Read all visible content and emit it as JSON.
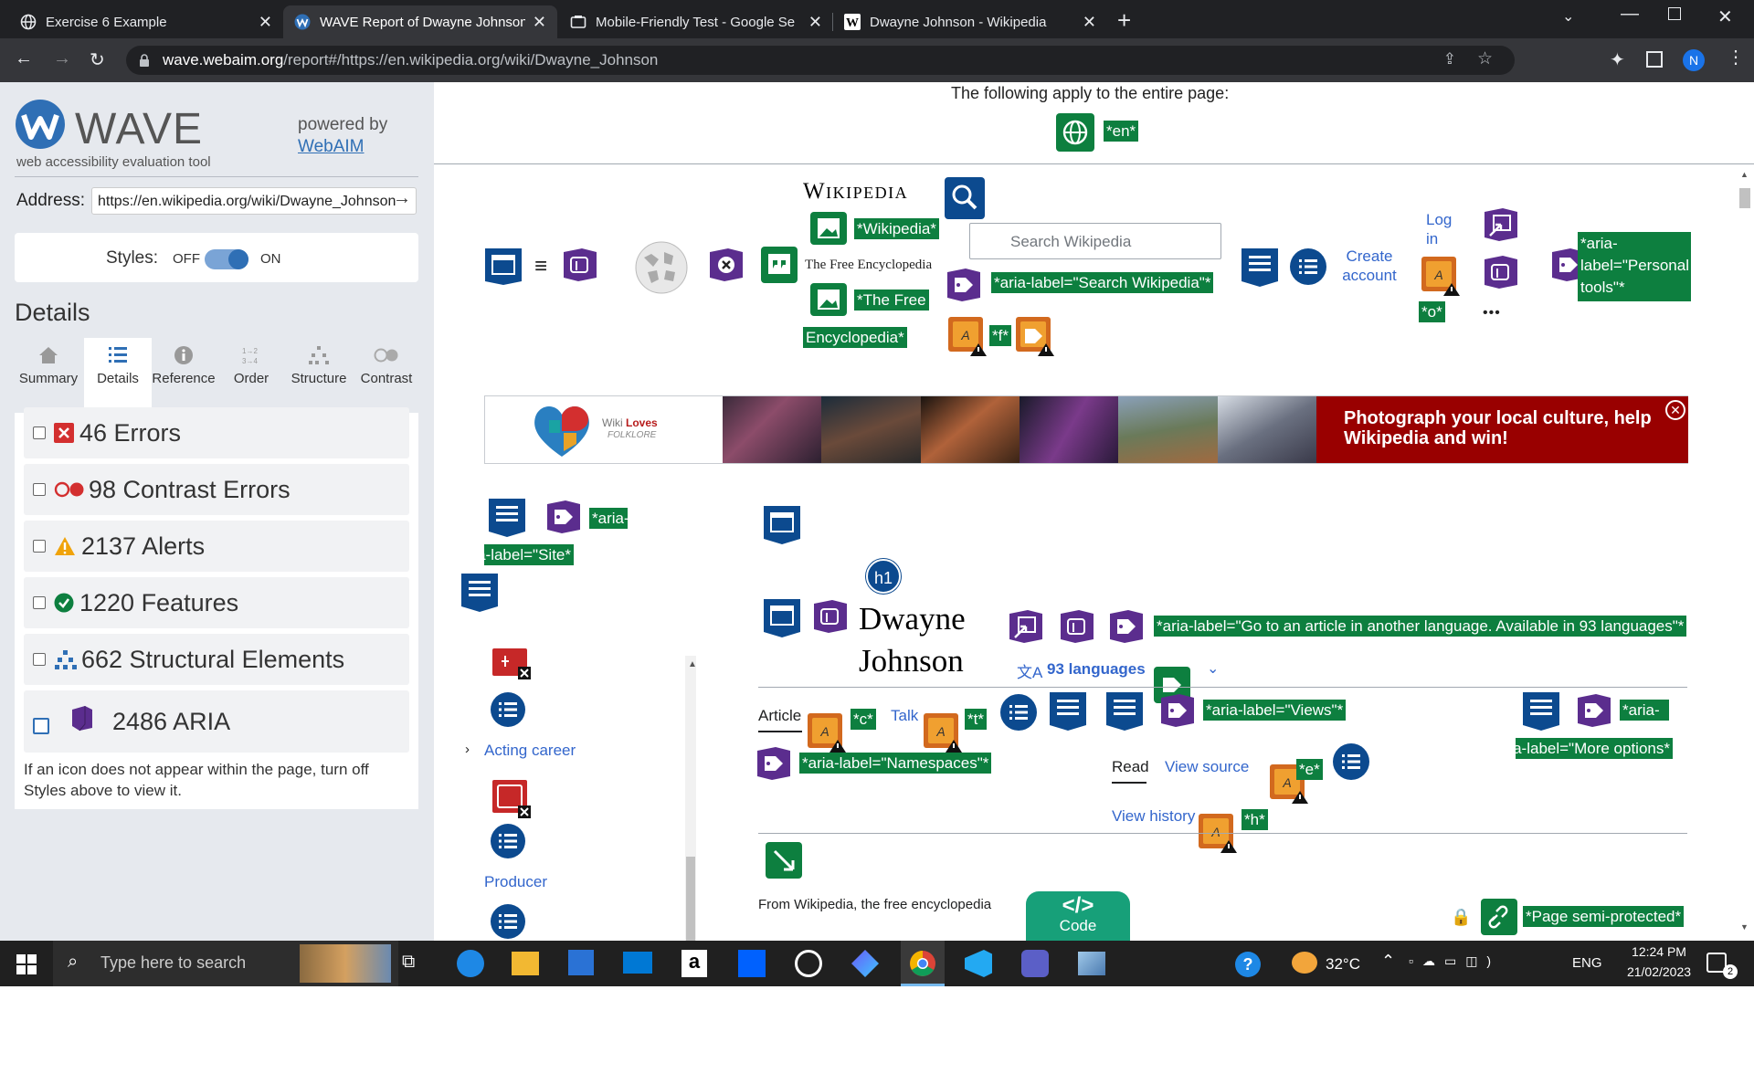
{
  "browser": {
    "tabs": [
      {
        "title": "Exercise 6 Example"
      },
      {
        "title": "WAVE Report of Dwayne Johnson"
      },
      {
        "title": "Mobile-Friendly Test - Google Se"
      },
      {
        "title": "Dwayne Johnson - Wikipedia"
      }
    ],
    "url_host": "wave.webaim.org",
    "url_path": "/report#/https://en.wikipedia.org/wiki/Dwayne_Johnson",
    "profile_initial": "N"
  },
  "sidebar": {
    "logo_text": "WAVE",
    "tagline": "web accessibility evaluation tool",
    "powered_by": "powered by",
    "webaim_link": "WebAIM",
    "address_label": "Address:",
    "address_value": "https://en.wikipedia.org/wiki/Dwayne_Johnson",
    "styles_label": "Styles:",
    "styles_off": "OFF",
    "styles_on": "ON",
    "details_heading": "Details",
    "tabs": [
      "Summary",
      "Details",
      "Reference",
      "Order",
      "Structure",
      "Contrast"
    ],
    "active_tab": "Details",
    "rows": [
      {
        "label": "46 Errors",
        "icon": "error-icon",
        "color": "#d32f2f"
      },
      {
        "label": "98 Contrast Errors",
        "icon": "contrast-icon",
        "color": "#d32f2f"
      },
      {
        "label": "2137 Alerts",
        "icon": "alert-icon",
        "color": "#f0a30a"
      },
      {
        "label": "1220 Features",
        "icon": "feature-icon",
        "color": "#0d7f3f"
      },
      {
        "label": "662 Structural Elements",
        "icon": "structure-icon",
        "color": "#2f6fb5"
      },
      {
        "label": "2486 ARIA",
        "icon": "aria-icon",
        "color": "#5b2d8e"
      }
    ],
    "note": "If an icon does not appear within the page, turn off Styles above to view it."
  },
  "content": {
    "page_note": "The following apply to the entire page:",
    "lang_tag": "*en*",
    "wiki_logo": "Wikipedia",
    "tag_wikipedia": "*Wikipedia*",
    "free_enc": "The Free Encyclopedia",
    "tag_free": "*The Free",
    "tag_encyclopedia": "Encyclopedia*",
    "search_placeholder": "Search Wikipedia",
    "tag_search": "*aria-label=\"Search Wikipedia\"*",
    "tag_f": "*f*",
    "create_account": "Create account",
    "log_in": "Log in",
    "tag_o": "*o*",
    "ellipsis": "•••",
    "tag_personal": "*aria-label=\"Personal tools\"*",
    "banner_logo_a": "Wiki ",
    "banner_logo_b": "Loves",
    "banner_logo_c": "FOLKLORE",
    "banner_text": "Photograph your local culture, help Wikipedia and win!",
    "tag_site": "*aria-label=\"Site\"*",
    "h1_badge": "h1",
    "title_line1": "Dwayne",
    "title_line2": "Johnson",
    "tag_languages": "*aria-label=\"Go to an article in another language. Available in 93 languages\"*",
    "languages": "93 languages",
    "tab_article": "Article",
    "tag_c": "*c*",
    "tab_talk": "Talk",
    "tag_t": "*t*",
    "tag_views": "*aria-label=\"Views\"*",
    "tag_more": "*aria-label=\"More options\"*",
    "tag_namespaces": "*aria-label=\"Namespaces\"*",
    "read": "Read",
    "view_source": "View source",
    "tag_e": "*e*",
    "view_history": "View history",
    "tag_h": "*h*",
    "from_wiki": "From Wikipedia, the free encyclopedia",
    "code_button": "Code",
    "tag_protected": "*Page semi-protected*",
    "toc": [
      "Acting career",
      "Producer"
    ]
  },
  "taskbar": {
    "search_placeholder": "Type here to search",
    "temperature": "32°C",
    "language": "ENG",
    "time": "12:24 PM",
    "date": "21/02/2023",
    "notifications": "2"
  }
}
